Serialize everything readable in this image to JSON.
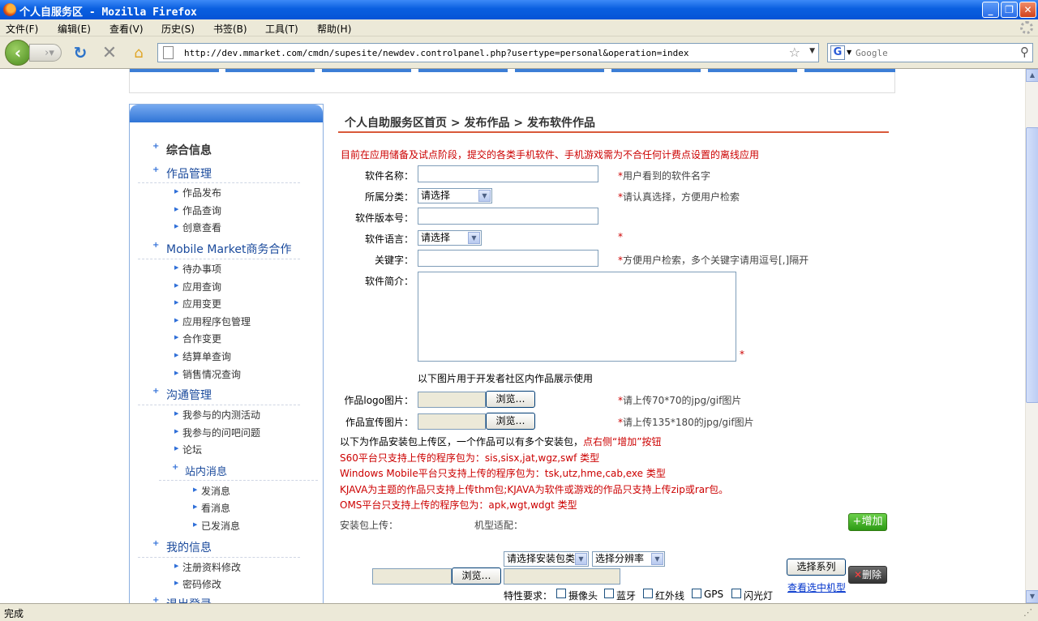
{
  "window": {
    "title": "个人自服务区 - Mozilla Firefox",
    "minimize": "_",
    "maximize": "❐",
    "close": "✕"
  },
  "menu": [
    "文件(F)",
    "编辑(E)",
    "查看(V)",
    "历史(S)",
    "书签(B)",
    "工具(T)",
    "帮助(H)"
  ],
  "nav": {
    "url": "http://dev.mmarket.com/cmdn/supesite/newdev.controlpanel.php?usertype=personal&operation=index",
    "search_placeholder": "Google",
    "search_engine_letter": "G"
  },
  "sidebar": {
    "sections": [
      {
        "label": "综合信息",
        "style": "bold",
        "items": []
      },
      {
        "label": "作品管理",
        "style": "blue",
        "items": [
          "作品发布",
          "作品查询",
          "创意查看"
        ]
      },
      {
        "label": "Mobile Market商务合作",
        "style": "blue",
        "items": [
          "待办事项",
          "应用查询",
          "应用变更",
          "应用程序包管理",
          "合作变更",
          "结算单查询",
          "销售情况查询"
        ]
      },
      {
        "label": "沟通管理",
        "style": "blue",
        "items": [
          "我参与的内测活动",
          "我参与的问吧问题",
          "论坛"
        ]
      },
      {
        "label": "站内消息",
        "style": "sub",
        "items": [
          "发消息",
          "看消息",
          "已发消息"
        ]
      },
      {
        "label": "我的信息",
        "style": "blue",
        "items": [
          "注册资料修改",
          "密码修改"
        ]
      },
      {
        "label": "退出登录",
        "style": "blue",
        "items": []
      }
    ]
  },
  "main": {
    "breadcrumb": "个人自助服务区首页 > 发布作品 > 发布软件作品",
    "notice": "目前在应用储备及试点阶段，提交的各类手机软件、手机游戏需为不合任何计费点设置的离线应用",
    "fields": {
      "name_label": "软件名称：",
      "name_hint": "用户看到的软件名字",
      "category_label": "所属分类：",
      "category_value": "请选择",
      "category_hint": "请认真选择，方便用户检索",
      "version_label": "软件版本号：",
      "language_label": "软件语言：",
      "language_value": "请选择",
      "keyword_label": "关键字：",
      "keyword_hint": "方便用户检索，多个关键字请用逗号[,]隔开",
      "intro_label": "软件简介："
    },
    "image_note": "以下图片用于开发者社区内作品展示使用",
    "logo_label": "作品logo图片：",
    "logo_hint": "请上传70*70的jpg/gif图片",
    "promo_label": "作品宣传图片：",
    "promo_hint": "请上传135*180的jpg/gif图片",
    "browse": "浏览…",
    "star": "*",
    "upload_note_black": "以下为作品安装包上传区，一个作品可以有多个安装包，",
    "upload_note_red": "点右侧“增加”按钮",
    "platform_rules": [
      "S60平台只支持上传的程序包为：sis,sisx,jat,wgz,swf 类型",
      "Windows Mobile平台只支持上传的程序包为：tsk,utz,hme,cab,exe 类型",
      "KJAVA为主题的作品只支持上传thm包;KJAVA为软件或游戏的作品只支持上传zip或rar包。",
      "OMS平台只支持上传的程序包为：apk,wgt,wdgt 类型"
    ],
    "pkg_upload_label": "安装包上传：",
    "model_label": "机型适配：",
    "add_button": "增加",
    "pkg_type_select": "请选择安装包类",
    "resolution_select": "选择分辨率",
    "series_button": "选择系列",
    "view_models_link": "查看选中机型",
    "delete_button": "删除",
    "features_label": "特性要求：",
    "features": [
      "摄像头",
      "蓝牙",
      "红外线",
      "GPS",
      "闪光灯"
    ]
  },
  "status": {
    "text": "完成"
  },
  "colors": {
    "accent_blue": "#3c7ed6",
    "notice_red": "#cc0000",
    "crumb_line": "#d9593a",
    "add_green": "#2c9a14"
  }
}
